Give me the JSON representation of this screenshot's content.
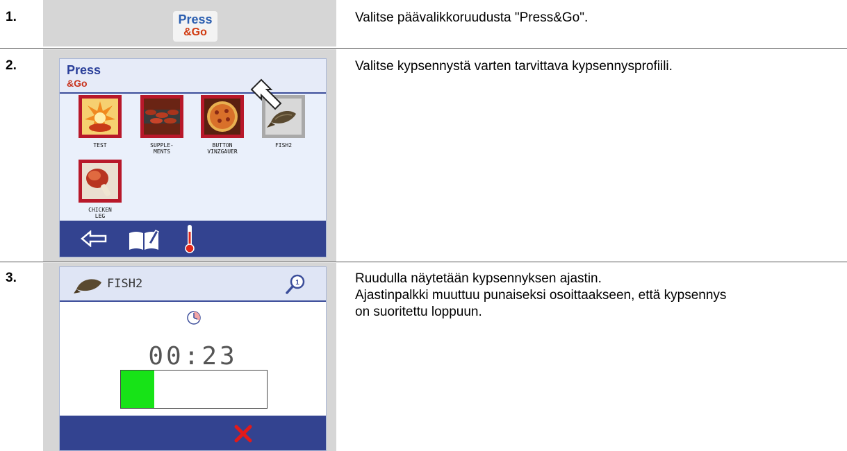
{
  "steps": [
    {
      "number": "1.",
      "text": "Valitse päävalikkoruudusta \"Press&Go\".",
      "icon": {
        "line1": "Press",
        "line2": "&Go"
      }
    },
    {
      "number": "2.",
      "text": "Valitse kypsennystä varten tarvittava kypsennysprofiili.",
      "screen": {
        "logo_line1": "Press",
        "logo_line2": "&Go",
        "tiles": [
          {
            "label": "TEST",
            "icon": "explosion-icon"
          },
          {
            "label": "SUPPLE-\nMENTS",
            "icon": "sausages-icon"
          },
          {
            "label": "BUTTON\nVINZGAUER",
            "icon": "pizza-icon"
          },
          {
            "label": "FISH2",
            "icon": "fish-icon"
          },
          {
            "label": "CHICKEN\nLEG",
            "icon": "chicken-leg-icon"
          }
        ],
        "footer_icons": [
          "back-arrow-icon",
          "recipe-book-icon",
          "thermometer-icon"
        ]
      }
    },
    {
      "number": "3.",
      "text_lines": [
        "Ruudulla näytetään kypsennyksen ajastin.",
        "Ajastinpalkki muuttuu punaiseksi osoittaakseen, että kypsennys",
        "on suoritettu loppuun."
      ],
      "screen": {
        "title": "FISH2",
        "timer": "00:23",
        "progress": 0.23,
        "footer_icon": "cancel-x-icon"
      }
    }
  ],
  "colors": {
    "accent_blue": "#334390",
    "tile_red": "#b8182a",
    "progress_green": "#17e317",
    "cancel_red": "#e21a1a"
  }
}
